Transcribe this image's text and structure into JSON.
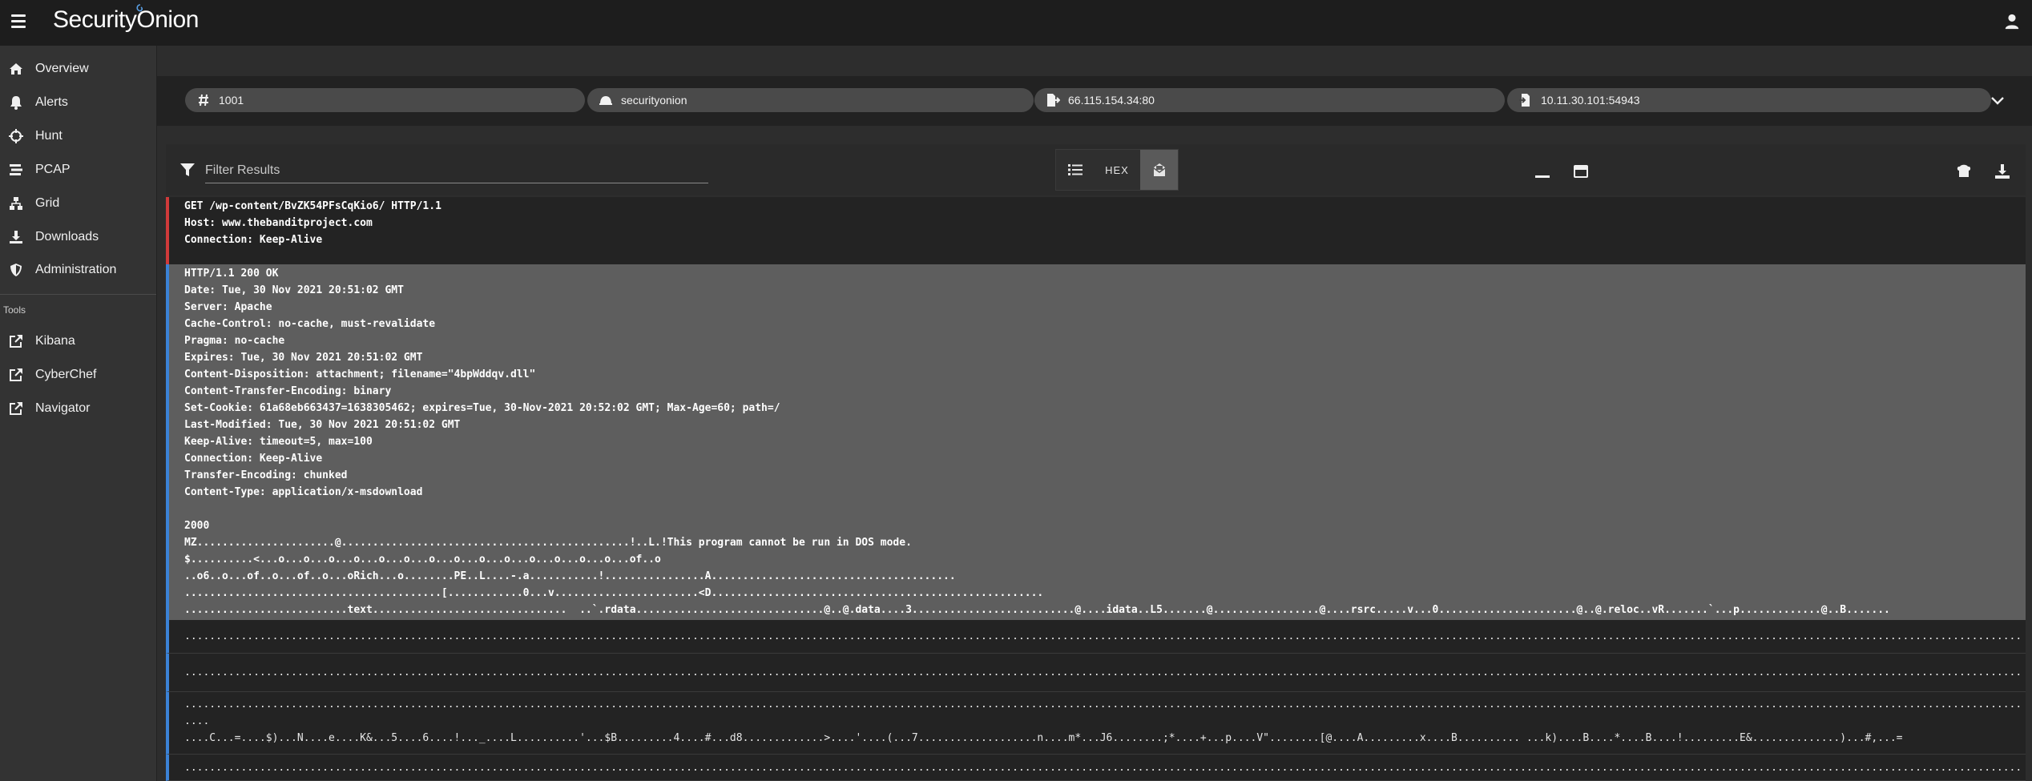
{
  "app": {
    "logo_text_1": "Security",
    "logo_text_2": "Onion"
  },
  "sidebar": {
    "items": [
      {
        "label": "Overview",
        "icon": "home-icon"
      },
      {
        "label": "Alerts",
        "icon": "bell-icon"
      },
      {
        "label": "Hunt",
        "icon": "crosshairs-icon"
      },
      {
        "label": "PCAP",
        "icon": "stream-icon"
      },
      {
        "label": "Grid",
        "icon": "network-icon"
      },
      {
        "label": "Downloads",
        "icon": "download-icon"
      },
      {
        "label": "Administration",
        "icon": "shield-icon"
      }
    ],
    "tools_header": "Tools",
    "tools": [
      {
        "label": "Kibana",
        "icon": "external-link-icon"
      },
      {
        "label": "CyberChef",
        "icon": "external-link-icon"
      },
      {
        "label": "Navigator",
        "icon": "external-link-icon"
      }
    ]
  },
  "chips": [
    {
      "text": "1001",
      "icon": "hash-icon"
    },
    {
      "text": "securityonion",
      "icon": "sensor-icon"
    },
    {
      "text": "66.115.154.34:80",
      "icon": "file-export-icon"
    },
    {
      "text": "10.11.30.101:54943",
      "icon": "file-import-icon"
    }
  ],
  "toolbar": {
    "filter_placeholder": "Filter Results",
    "hex_label": "HEX"
  },
  "request": {
    "lines": "GET /wp-content/BvZK54PFsCqKio6/ HTTP/1.1\nHost: www.thebanditproject.com\nConnection: Keep-Alive"
  },
  "response": {
    "lines": "HTTP/1.1 200 OK\nDate: Tue, 30 Nov 2021 20:51:02 GMT\nServer: Apache\nCache-Control: no-cache, must-revalidate\nPragma: no-cache\nExpires: Tue, 30 Nov 2021 20:51:02 GMT\nContent-Disposition: attachment; filename=\"4bpWddqv.dll\"\nContent-Transfer-Encoding: binary\nSet-Cookie: 61a68eb663437=1638305462; expires=Tue, 30-Nov-2021 20:52:02 GMT; Max-Age=60; path=/\nLast-Modified: Tue, 30 Nov 2021 20:51:02 GMT\nKeep-Alive: timeout=5, max=100\nConnection: Keep-Alive\nTransfer-Encoding: chunked\nContent-Type: application/x-msdownload\n\n2000\nMZ......................@..............................................!..L.!This program cannot be run in DOS mode.\n$..........<...o...o...o...o...o...o...o...o...o...o...o...o...o...o...of..o\n..o6..o...of..o...of..o...oRich...o........PE..L....-.a...........!................A.......................................\n.........................................[............0...v.......................<D.....................................................\n..........................text...............................  ..`.rdata..............................@..@.data....3..........................@....idata..L5.......@.................@....rsrc.....v...0......................@..@.reloc..vR.......`...p.............@..B......."
  },
  "rows": [
    "...................................................................................................................................................................................................................................................................................................................................................",
    "...................................................................................................................................................................................................................................................................................................................................................",
    "...................................................................................................................................................................................................................................................................................................................................................\n....\n....C...=....$)...N....e....K&...5....6....!..._....L..........'...$B.........4....#...d8.............>....'....(...7...................n....m*...J6........;*....+...p....V\"........[@....A.........x....B.......... ...k)....B....*....B....!.........E&..............)...#,...=",
    "..................................................................................................................................................................................................................................................................................................................................................."
  ]
}
